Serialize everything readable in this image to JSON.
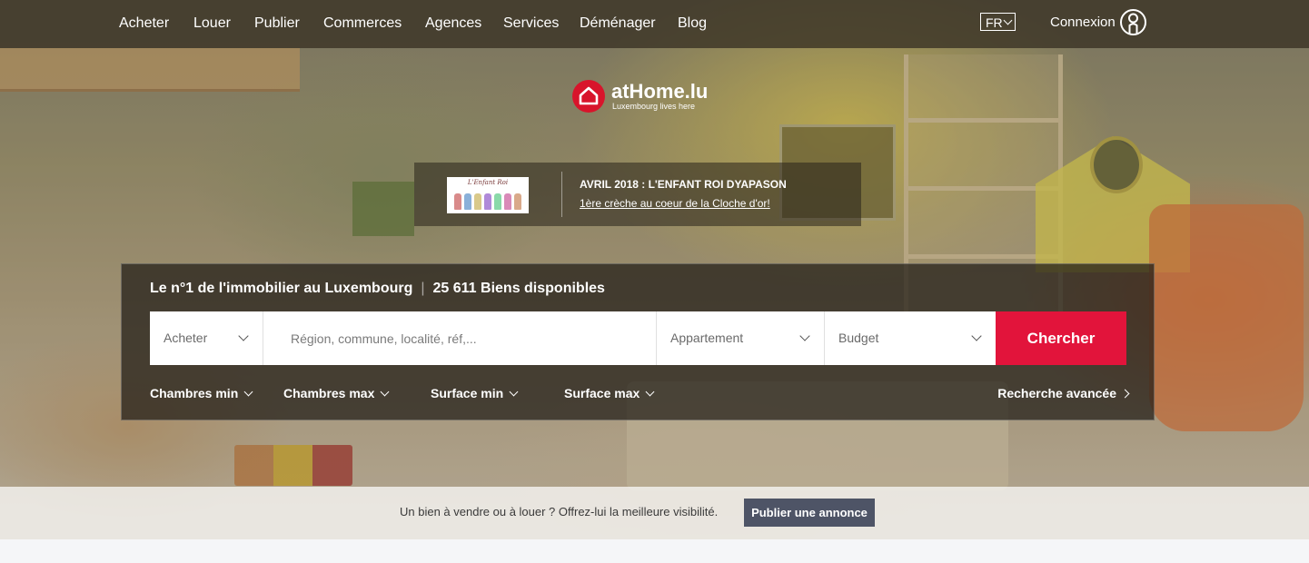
{
  "nav": {
    "items": [
      "Acheter",
      "Louer",
      "Publier",
      "Commerces",
      "Agences",
      "Services",
      "Déménager",
      "Blog"
    ],
    "language": "FR",
    "login_label": "Connexion",
    "icons": {
      "user": "user-circle-icon",
      "lang_dropdown": "chevron-down-icon"
    }
  },
  "logo": {
    "name": "atHome.lu",
    "tagline": "Luxembourg lives here",
    "icon": "house-icon",
    "brand_color": "#d8142b"
  },
  "ad": {
    "thumb_text": "L'Enfant Roi",
    "title": "AVRIL 2018 : L'ENFANT ROI DYAPASON",
    "link": "1ère crèche au coeur de la Cloche d'or!"
  },
  "search": {
    "headline_left": "Le n°1 de l'immobilier au Luxembourg",
    "headline_sep": "|",
    "headline_right": "25 611 Biens disponibles",
    "transaction": "Acheter",
    "location_placeholder": "Région, commune, localité, réf,...",
    "location_value": "",
    "property_type": "Appartement",
    "budget": "Budget",
    "submit_label": "Chercher",
    "submit_color": "#e2143b",
    "filters": [
      "Chambres min",
      "Chambres max",
      "Surface min",
      "Surface max"
    ],
    "advanced_label": "Recherche avancée"
  },
  "cta": {
    "text": "Un bien à vendre ou à louer ? Offrez-lui la meilleure visibilité.",
    "button_label": "Publier une annonce",
    "button_color": "#4e5466"
  }
}
